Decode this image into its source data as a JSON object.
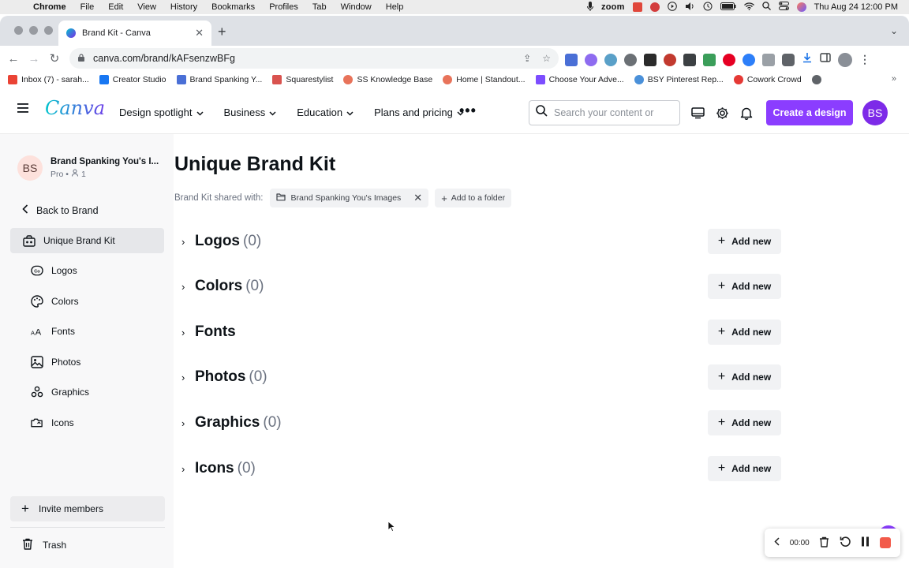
{
  "mac_menu": {
    "app": "Chrome",
    "items": [
      "File",
      "Edit",
      "View",
      "History",
      "Bookmarks",
      "Profiles",
      "Tab",
      "Window",
      "Help"
    ],
    "zoom_label": "zoom",
    "datetime": "Thu Aug 24  12:00 PM"
  },
  "browser": {
    "tab_title": "Brand Kit - Canva",
    "url": "canva.com/brand/kAFsenzwBFg",
    "bookmarks": [
      {
        "label": "Inbox (7) - sarah...",
        "color": "#ea4335"
      },
      {
        "label": "Creator Studio",
        "color": "#1877f2"
      },
      {
        "label": "Brand Spanking Y...",
        "color": "#4a6fd6"
      },
      {
        "label": "Squarestylist",
        "color": "#d9534f"
      },
      {
        "label": "SS Knowledge Base",
        "color": "#e8735a"
      },
      {
        "label": "Home | Standout...",
        "color": "#e8735a"
      },
      {
        "label": "Choose Your Adve...",
        "color": "#7c4dff"
      },
      {
        "label": "BSY Pinterest Rep...",
        "color": "#4a90d9"
      },
      {
        "label": "Cowork Crowd",
        "color": "#e53935"
      },
      {
        "label": "",
        "color": "#5f6368"
      }
    ]
  },
  "header": {
    "logo": "Canva",
    "nav": [
      "Design spotlight",
      "Business",
      "Education",
      "Plans and pricing"
    ],
    "search_placeholder": "Search your content or",
    "create_label": "Create a design",
    "avatar_initials": "BS"
  },
  "sidebar": {
    "brand_initials": "BS",
    "brand_name": "Brand Spanking You's I...",
    "brand_plan": "Pro •",
    "brand_members": "1",
    "back_label": "Back to Brand",
    "kit_label": "Unique Brand Kit",
    "items": [
      {
        "label": "Logos",
        "icon": "logo-icon"
      },
      {
        "label": "Colors",
        "icon": "palette-icon"
      },
      {
        "label": "Fonts",
        "icon": "font-icon"
      },
      {
        "label": "Photos",
        "icon": "photo-icon"
      },
      {
        "label": "Graphics",
        "icon": "graphics-icon"
      },
      {
        "label": "Icons",
        "icon": "icons-icon"
      }
    ],
    "invite_label": "Invite members",
    "trash_label": "Trash"
  },
  "main": {
    "title": "Unique Brand Kit",
    "shared_label": "Brand Kit shared with:",
    "shared_chip": "Brand Spanking You's Images",
    "folder_label": "Add to a folder",
    "add_label": "Add new",
    "sections": [
      {
        "name": "Logos",
        "count": "(0)"
      },
      {
        "name": "Colors",
        "count": "(0)"
      },
      {
        "name": "Fonts",
        "count": ""
      },
      {
        "name": "Photos",
        "count": "(0)"
      },
      {
        "name": "Graphics",
        "count": "(0)"
      },
      {
        "name": "Icons",
        "count": "(0)"
      }
    ]
  },
  "recorder": {
    "time": "00:00"
  },
  "colors": {
    "accent": "#8b3dff",
    "brand_avatar": "#7d2ae8",
    "active_item": "#e6e7ea"
  }
}
